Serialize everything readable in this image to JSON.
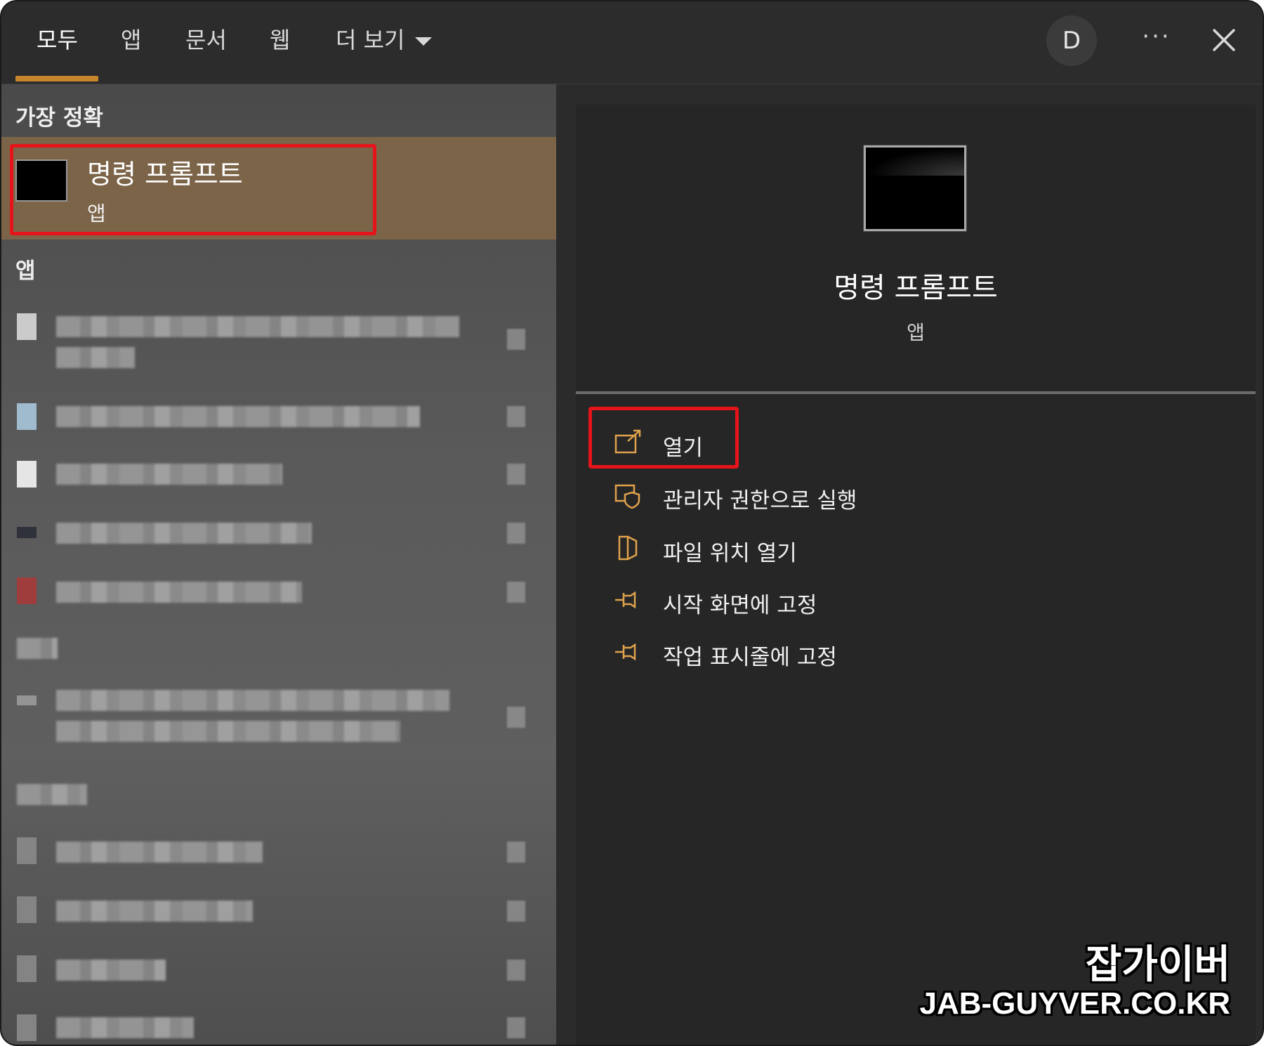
{
  "tabs": {
    "all": "모두",
    "apps": "앱",
    "documents": "문서",
    "web": "웹",
    "more": "더 보기"
  },
  "account": {
    "initial": "D"
  },
  "window": {
    "more_glyph": "···"
  },
  "left": {
    "best_match_label": "가장 정확",
    "best_match": {
      "title": "명령 프롬프트",
      "subtitle": "앱"
    },
    "apps_label": "앱"
  },
  "right": {
    "title": "명령 프롬프트",
    "subtitle": "앱",
    "actions": [
      {
        "label": "열기",
        "icon": "open-icon"
      },
      {
        "label": "관리자 권한으로 실행",
        "icon": "shield-icon"
      },
      {
        "label": "파일 위치 열기",
        "icon": "folder-icon"
      },
      {
        "label": "시작 화면에 고정",
        "icon": "pin-icon"
      },
      {
        "label": "작업 표시줄에 고정",
        "icon": "pin-icon"
      }
    ]
  },
  "colors": {
    "accent": "#c8862c",
    "highlight": "#e5141b",
    "selected_bg": "#7c6448"
  },
  "watermark": {
    "korean": "잡가이버",
    "english": "JAB-GUYVER.CO.KR"
  }
}
